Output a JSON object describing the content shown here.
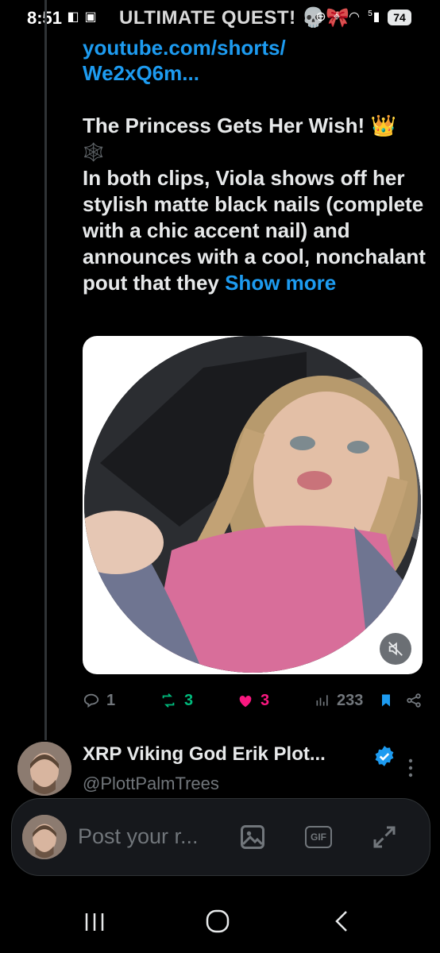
{
  "status_bar": {
    "time": "8:51",
    "overlap_text": "ULTIMATE QUEST! 💀🎀",
    "battery": "74",
    "network": "5"
  },
  "tweet": {
    "url_text": "youtube.com/shorts/\nWe2xQ6m...",
    "title_line": "The Princess Gets Her Wish! 👑",
    "emoji_line": "🕸️",
    "body": "In both clips, Viola shows off her stylish matte black nails (complete with a chic accent nail) and announces with a cool, nonchalant pout that they ",
    "show_more": "Show more"
  },
  "actions": {
    "replies": "1",
    "retweets": "3",
    "likes": "3",
    "views": "233"
  },
  "reply": {
    "name": "XRP Viking God Erik Plot...",
    "handle": "@PlottPalmTrees"
  },
  "compose": {
    "placeholder": "Post your r...",
    "gif_label": "GIF"
  },
  "colors": {
    "accent": "#1d9bf0",
    "retweet": "#00ba7c",
    "like": "#f91880",
    "muted": "#71767b"
  }
}
